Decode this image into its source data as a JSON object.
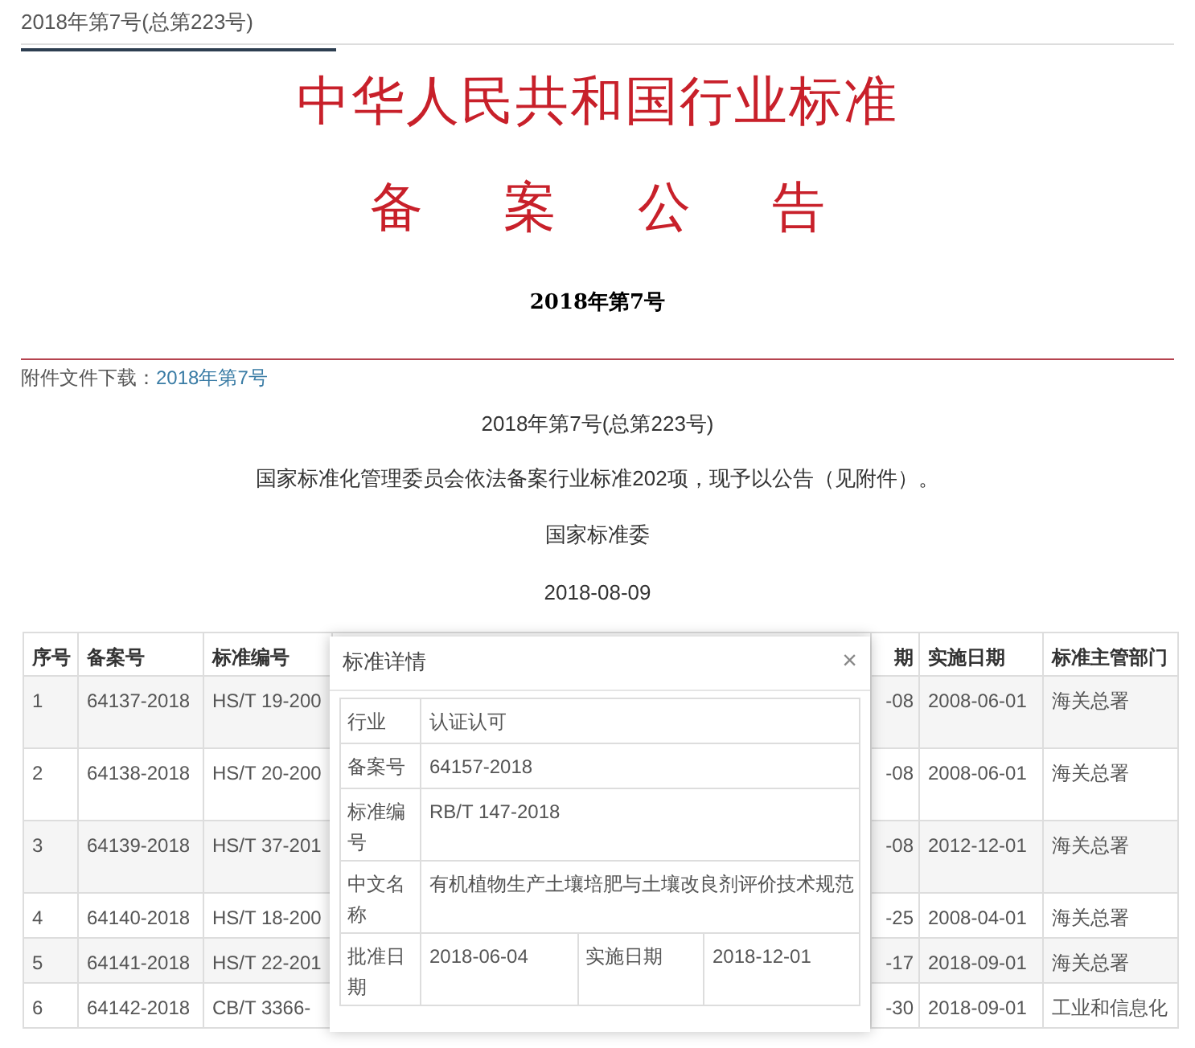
{
  "issue_tab": "2018年第7号(总第223号)",
  "title": "中华人民共和国行业标准",
  "subtitle": "备 案 公 告",
  "issue": "2018年第7号",
  "attachment": {
    "label": "附件文件下载：",
    "link": "2018年第7号"
  },
  "body": [
    "2018年第7号(总第223号)",
    "国家标准化管理委员会依法备案行业标准202项，现予以公告（见附件）。",
    "国家标准委",
    "2018-08-09"
  ],
  "table": {
    "columns": [
      "序号",
      "备案号",
      "标准编号",
      "期",
      "实施日期",
      "标准主管部门"
    ],
    "rows": [
      [
        "1",
        "64137-2018",
        "HS/T 19-200",
        "-08",
        "2008-06-01",
        "海关总署"
      ],
      [
        "2",
        "64138-2018",
        "HS/T 20-200",
        "-08",
        "2008-06-01",
        "海关总署"
      ],
      [
        "3",
        "64139-2018",
        "HS/T 37-201",
        "-08",
        "2012-12-01",
        "海关总署"
      ],
      [
        "4",
        "64140-2018",
        "HS/T 18-200",
        "-25",
        "2008-04-01",
        "海关总署"
      ],
      [
        "5",
        "64141-2018",
        "HS/T 22-201",
        "-17",
        "2018-09-01",
        "海关总署"
      ],
      [
        "6",
        "64142-2018",
        "CB/T 3366-",
        "-30",
        "2018-09-01",
        "工业和信息化"
      ]
    ]
  },
  "dialog": {
    "title": "标准详情",
    "close": "×",
    "rows": [
      [
        {
          "label": "行业",
          "value": "认证认可"
        }
      ],
      [
        {
          "label": "备案号",
          "value": "64157-2018"
        }
      ],
      [
        {
          "label": "标准编号",
          "value": "RB/T 147-2018"
        }
      ],
      [
        {
          "label": "中文名称",
          "value": "有机植物生产土壤培肥与土壤改良剂评价技术规范"
        }
      ],
      [
        {
          "label": "批准日期",
          "value": "2018-06-04"
        },
        {
          "label": "实施日期",
          "value": "2018-12-01"
        }
      ]
    ]
  }
}
